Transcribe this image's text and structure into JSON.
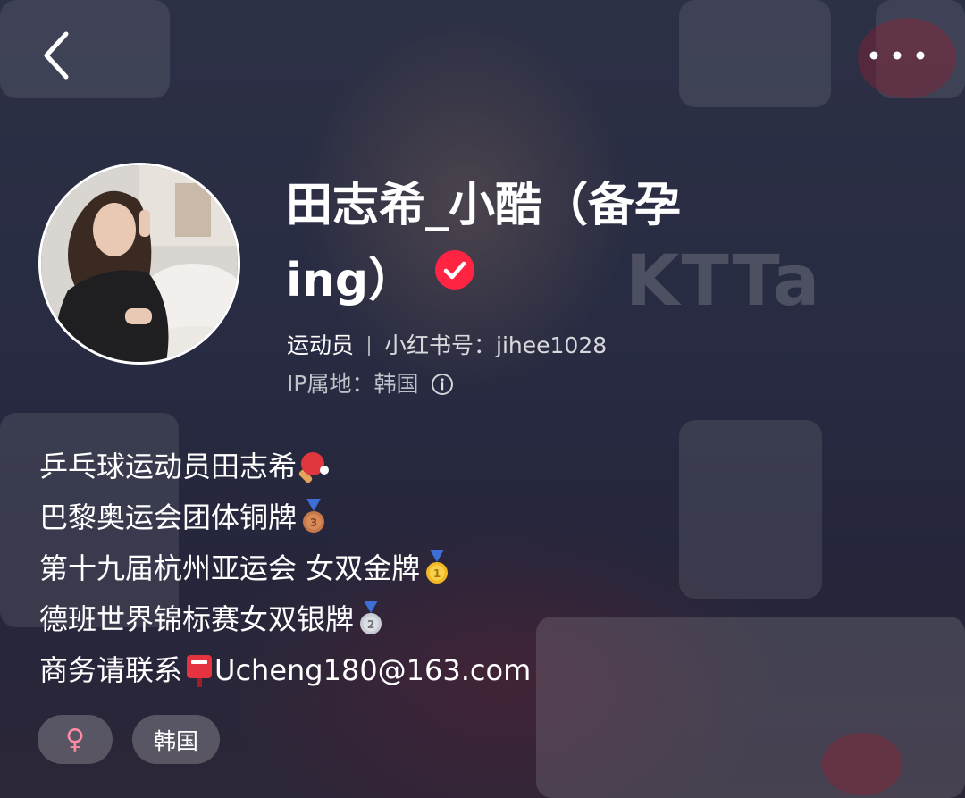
{
  "profile": {
    "nickname": "田志希_小酷（备孕ing）",
    "role": "运动员",
    "red_id_label": "小红书号：",
    "red_id": "jihee1028",
    "ip_label": "IP属地：",
    "ip_location": "韩国",
    "bio": [
      {
        "text": "乒乓球运动员田志希",
        "emoji": "ping-pong-paddle-icon"
      },
      {
        "text": "巴黎奥运会团体铜牌",
        "emoji": "bronze-medal-icon"
      },
      {
        "text": "第十九届杭州亚运会 女双金牌",
        "emoji": "gold-medal-icon"
      },
      {
        "text": "德班世界锦标赛女双银牌",
        "emoji": "silver-medal-icon"
      },
      {
        "prefix": "商务请联系",
        "emoji": "postbox-icon",
        "text": "Ucheng180@163.com"
      }
    ],
    "tags": {
      "gender_symbol": "♀",
      "region": "韩国"
    }
  },
  "background_watermark": "KTTa",
  "colors": {
    "verified": "#ff2442",
    "gold": "#f2b925",
    "silver": "#c9ccd2",
    "bronze": "#c8794a",
    "gender_pink": "#ff8aa6"
  },
  "icons": {
    "back": "chevron-left-icon",
    "more": "more-dots-icon",
    "verified": "verified-check-icon",
    "info": "info-circle-icon"
  }
}
